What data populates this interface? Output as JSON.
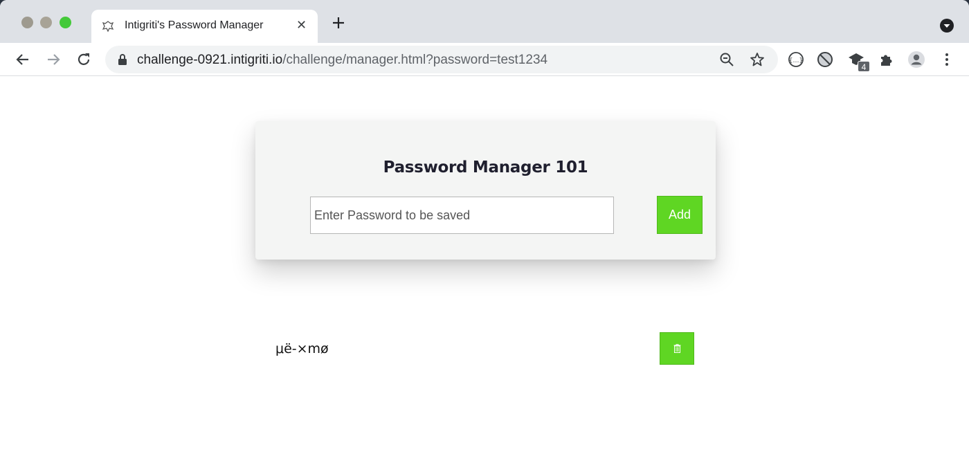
{
  "browser": {
    "tab": {
      "title": "Intigriti's Password Manager",
      "close_glyph": "✕"
    },
    "new_tab_glyph": "+",
    "omnibox": {
      "url_host": "challenge-0921.intigriti.io",
      "url_path": "/challenge/manager.html?password=test1234"
    },
    "extensions_badge": "4",
    "icons": [
      "back-arrow-icon",
      "forward-arrow-icon",
      "reload-icon",
      "lock-icon",
      "zoom-icon",
      "star-icon",
      "extension-icons",
      "puzzle-icon",
      "profile-icon",
      "menu-icon"
    ]
  },
  "manager": {
    "title": "Password Manager 101",
    "input_placeholder": "Enter Password to be saved",
    "add_label": "Add",
    "saved_passwords": [
      "μë-×mø"
    ]
  },
  "colors": {
    "accent": "#5fd623"
  }
}
